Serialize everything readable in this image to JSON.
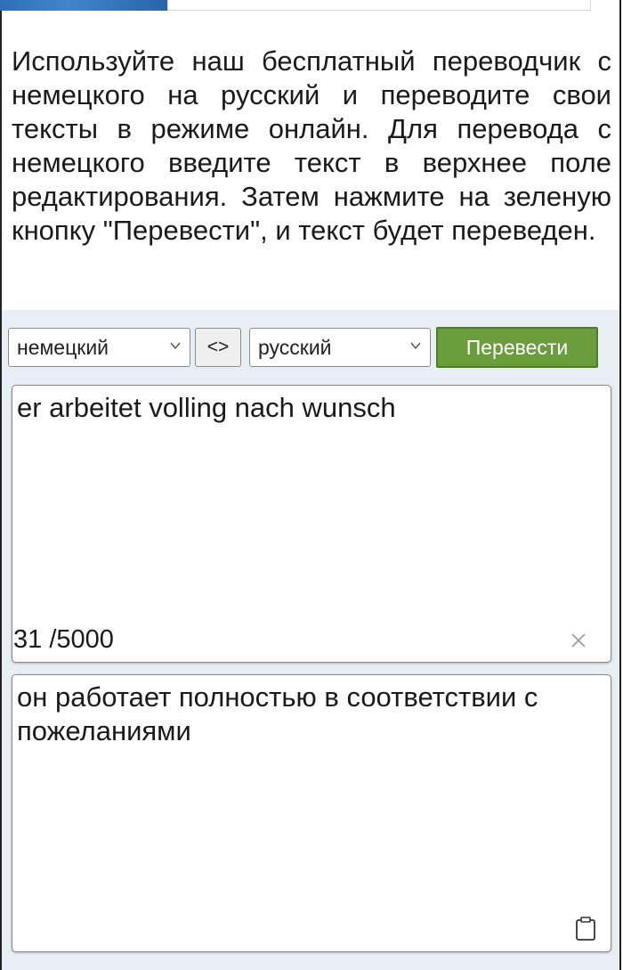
{
  "intro": {
    "text": "Используйте наш бесплатный переводчик с немецкого на русский и переводите свои тексты в режиме онлайн. Для перевода с немецкого введите текст в верхнее поле редактирования. Затем нажмите на зеленую кнопку \"Перевести\", и текст будет переведен."
  },
  "toolbar": {
    "source_language": "немецкий",
    "swap_label": "<>",
    "target_language": "русский",
    "translate_label": "Перевести"
  },
  "source": {
    "text": "er arbeitet volling nach wunsch",
    "counter": "31 /5000",
    "clear_icon": "close-icon"
  },
  "target": {
    "text": "он работает полностью в соответствии с пожеланиями",
    "copy_icon": "clipboard-icon"
  },
  "colors": {
    "translate_button": "#6a9d3c",
    "tool_background": "#e9edf4",
    "top_image": "#2d6fb8"
  }
}
